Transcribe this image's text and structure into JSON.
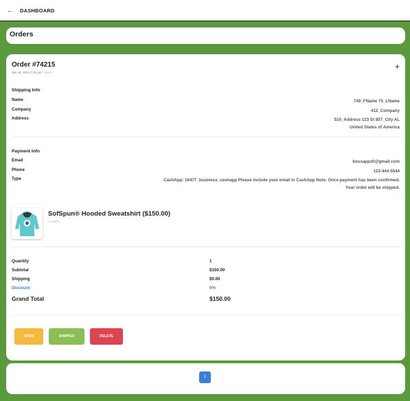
{
  "topbar": {
    "back_icon": "arrow-left-icon",
    "title": "DASHBOARD"
  },
  "orders": {
    "title": "Orders"
  },
  "order": {
    "title": "Order #74215",
    "date": "Jan 24, 2024 7:32 pm",
    "separator": " - ",
    "status": "Open",
    "expand_icon": "plus-icon",
    "shipping": {
      "title": "Shipping Info",
      "name_label": "Name",
      "name": "749_FName 75_LName",
      "company_label": "Company",
      "company": "412_Company",
      "address_label": "Address",
      "address_line1": "510_Address 123 St 857_City AL",
      "address_line2": "United States of America"
    },
    "payment": {
      "title": "Payment Info",
      "email_label": "Email",
      "email": "bossappz0@gmail.com",
      "phone_label": "Phone",
      "phone": "123-444-5544",
      "type_label": "Type",
      "type_line1": "CashApp: 16477_business_cashapp Please include your email in CashApp Note. Once payment has been confirmed.",
      "type_line2": "Your order will be shipped."
    },
    "product": {
      "image_icon": "hoodie-image",
      "name": "SofSpun® Hooded Sweatshirt ($150.00)",
      "variant": "1x Mam"
    },
    "summary": {
      "quantity_label": "Quantity",
      "quantity": "1",
      "subtotal_label": "Subtotal",
      "subtotal": "$150.00",
      "shipping_label": "Shipping",
      "shipping": "$0.00",
      "discount_label": "Discount",
      "discount": "0%",
      "grand_label": "Grand Total",
      "grand": "$150.00"
    },
    "buttons": {
      "open": "OPEN",
      "shipped": "SHIPPED",
      "delete": "DELETE"
    }
  },
  "pagination": {
    "current": "1"
  },
  "colors": {
    "background": "#5a9a3c",
    "open": "#f5b940",
    "shipped": "#8bbf54",
    "delete": "#dc4450",
    "page": "#3a7fd6",
    "discount": "#3a86d8"
  }
}
